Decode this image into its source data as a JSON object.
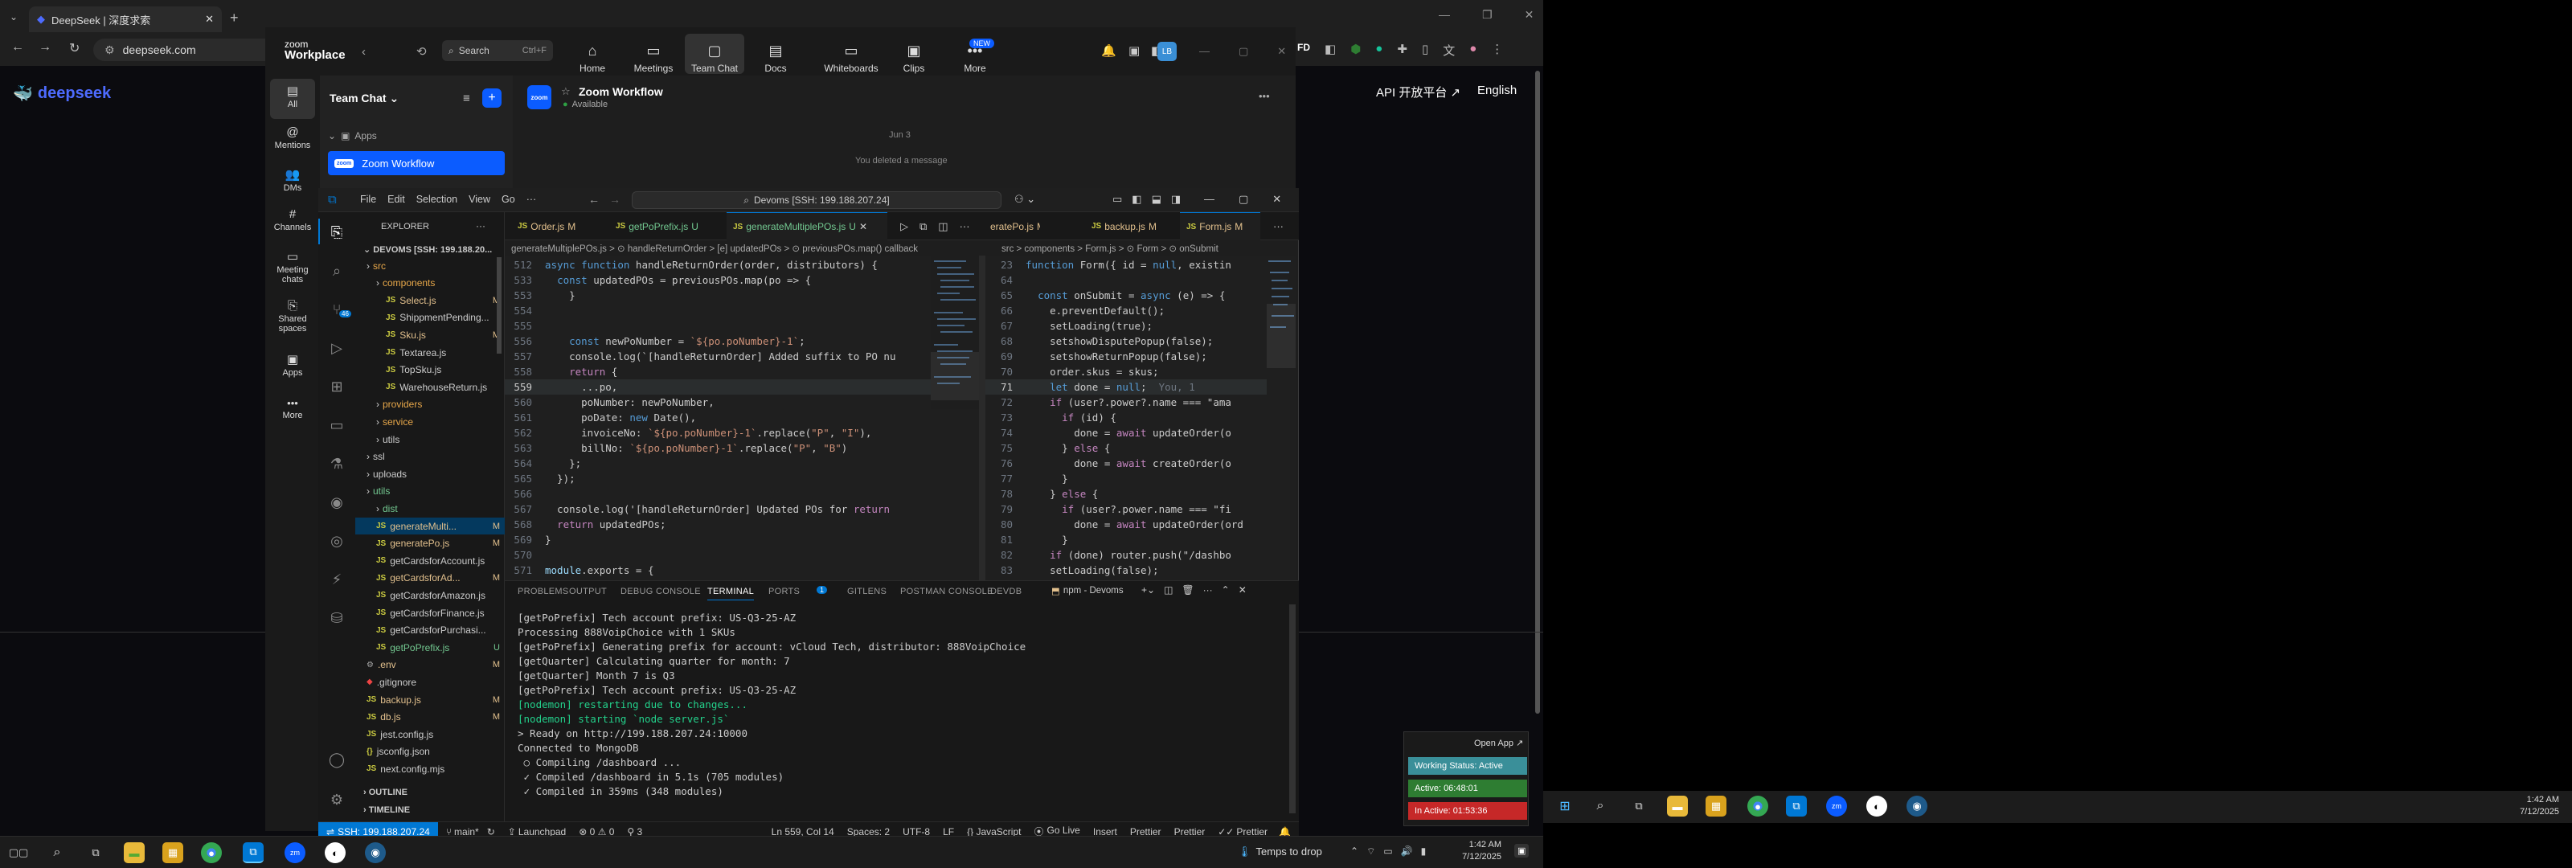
{
  "browser": {
    "tab_title": "DeepSeek | 深度求索",
    "url": "deepseek.com",
    "new_tab": "+"
  },
  "deepseek": {
    "logo_text": "deepseek",
    "api_link": "API 开放平台 ↗",
    "language": "English"
  },
  "zoom": {
    "app_name": "zoom",
    "app_sub": "Workplace",
    "search_placeholder": "Search",
    "search_shortcut": "Ctrl+F",
    "nav": [
      {
        "label": "Home",
        "icon": "home-icon"
      },
      {
        "label": "Meetings",
        "icon": "camera-icon"
      },
      {
        "label": "Team Chat",
        "icon": "chat-icon"
      },
      {
        "label": "Docs",
        "icon": "docs-icon"
      },
      {
        "label": "Whiteboards",
        "icon": "whiteboard-icon"
      },
      {
        "label": "Clips",
        "icon": "clips-icon"
      },
      {
        "label": "More",
        "icon": "more-icon"
      }
    ],
    "new_badge": "NEW",
    "avatar_initials": "LB",
    "rail": [
      "All",
      "Mentions",
      "DMs",
      "Channels",
      "Meeting chats",
      "Shared spaces",
      "Apps",
      "More"
    ],
    "list_title": "Team Chat",
    "apps_section": "Apps",
    "selected_item": "Zoom Workflow",
    "chat_title": "Zoom Workflow",
    "chat_status": "Available",
    "date_label": "Jun 3",
    "deleted_msg": "You deleted a message"
  },
  "vscode": {
    "menu": [
      "File",
      "Edit",
      "Selection",
      "View",
      "Go",
      "···"
    ],
    "command_center": "Devoms [SSH: 199.188.207.24]",
    "explorer_title": "EXPLORER",
    "root": "DEVOMS [SSH: 199.188.20...",
    "tree": [
      {
        "name": "src",
        "type": "folder",
        "depth": 0,
        "color": "#e8a84a"
      },
      {
        "name": "components",
        "type": "folder",
        "depth": 1,
        "color": "#e8a84a"
      },
      {
        "name": "Select.js",
        "type": "js",
        "depth": 2,
        "status": "M"
      },
      {
        "name": "ShippmentPending...",
        "type": "js",
        "depth": 2,
        "status": ""
      },
      {
        "name": "Sku.js",
        "type": "js",
        "depth": 2,
        "status": "M"
      },
      {
        "name": "Textarea.js",
        "type": "js",
        "depth": 2,
        "status": ""
      },
      {
        "name": "TopSku.js",
        "type": "js",
        "depth": 2,
        "status": ""
      },
      {
        "name": "WarehouseReturn.js",
        "type": "js",
        "depth": 2,
        "status": ""
      },
      {
        "name": "providers",
        "type": "folder",
        "depth": 1,
        "color": "#e8a84a"
      },
      {
        "name": "service",
        "type": "folder",
        "depth": 1,
        "color": "#e8a84a"
      },
      {
        "name": "utils",
        "type": "folder",
        "depth": 1,
        "color": "#ccc"
      },
      {
        "name": "ssl",
        "type": "folder",
        "depth": 0,
        "color": "#ccc"
      },
      {
        "name": "uploads",
        "type": "folder",
        "depth": 0,
        "color": "#ccc"
      },
      {
        "name": "utils",
        "type": "folder",
        "depth": 0,
        "color": "#73c991"
      },
      {
        "name": "dist",
        "type": "folder",
        "depth": 1,
        "color": "#73c991"
      },
      {
        "name": "generateMulti...",
        "type": "js",
        "depth": 1,
        "status": "M",
        "active": true
      },
      {
        "name": "generatePo.js",
        "type": "js",
        "depth": 1,
        "status": "M"
      },
      {
        "name": "getCardsforAccount.js",
        "type": "js",
        "depth": 1,
        "status": ""
      },
      {
        "name": "getCardsforAd...",
        "type": "js",
        "depth": 1,
        "status": "M"
      },
      {
        "name": "getCardsforAmazon.js",
        "type": "js",
        "depth": 1,
        "status": ""
      },
      {
        "name": "getCardsforFinance.js",
        "type": "js",
        "depth": 1,
        "status": ""
      },
      {
        "name": "getCardsforPurchasi...",
        "type": "js",
        "depth": 1,
        "status": ""
      },
      {
        "name": "getPoPrefix.js",
        "type": "js",
        "depth": 1,
        "status": "U"
      },
      {
        "name": ".env",
        "type": "env",
        "depth": 0,
        "status": "M"
      },
      {
        "name": ".gitignore",
        "type": "git",
        "depth": 0,
        "status": ""
      },
      {
        "name": "backup.js",
        "type": "js",
        "depth": 0,
        "status": "M"
      },
      {
        "name": "db.js",
        "type": "js",
        "depth": 0,
        "status": "M"
      },
      {
        "name": "jest.config.js",
        "type": "js",
        "depth": 0,
        "status": ""
      },
      {
        "name": "jsconfig.json",
        "type": "json",
        "depth": 0,
        "status": ""
      },
      {
        "name": "next.config.mjs",
        "type": "js",
        "depth": 0,
        "status": ""
      }
    ],
    "outline": "OUTLINE",
    "timeline": "TIMELINE",
    "tabs_left": [
      {
        "name": "Order.js",
        "status": "M"
      },
      {
        "name": "getPoPrefix.js",
        "status": "U"
      },
      {
        "name": "generateMultiplePOs.js",
        "status": "U",
        "active": true
      }
    ],
    "tabs_right": [
      {
        "name": "eratePo.js",
        "status": "M"
      },
      {
        "name": "backup.js",
        "status": "M"
      },
      {
        "name": "Form.js",
        "status": "M",
        "active": true
      }
    ],
    "breadcrumb_left": "generateMultiplePOs.js > ⊙ handleReturnOrder > [e] updatedPOs > ⊙ previousPOs.map() callback",
    "breadcrumb_right": "src > components > Form.js > ⊙ Form > ⊙ onSubmit",
    "left_lines": [
      {
        "n": "512",
        "code": "async function handleReturnOrder(order, distributors) {"
      },
      {
        "n": "533",
        "code": "  const updatedPOs = previousPOs.map(po => {"
      },
      {
        "n": "553",
        "code": "    }"
      },
      {
        "n": "554",
        "code": ""
      },
      {
        "n": "555",
        "code": ""
      },
      {
        "n": "556",
        "code": "    const newPoNumber = `${po.poNumber}-1`;"
      },
      {
        "n": "557",
        "code": "    console.log(`[handleReturnOrder] Added suffix to PO nu"
      },
      {
        "n": "558",
        "code": "    return {"
      },
      {
        "n": "559",
        "code": "      ...po,"
      },
      {
        "n": "560",
        "code": "      poNumber: newPoNumber,"
      },
      {
        "n": "561",
        "code": "      poDate: new Date(),"
      },
      {
        "n": "562",
        "code": "      invoiceNo: `${po.poNumber}-1`.replace(\"P\", \"I\"),"
      },
      {
        "n": "563",
        "code": "      billNo: `${po.poNumber}-1`.replace(\"P\", \"B\")"
      },
      {
        "n": "564",
        "code": "    };"
      },
      {
        "n": "565",
        "code": "  });"
      },
      {
        "n": "566",
        "code": ""
      },
      {
        "n": "567",
        "code": "  console.log('[handleReturnOrder] Updated POs for return "
      },
      {
        "n": "568",
        "code": "  return updatedPOs;"
      },
      {
        "n": "569",
        "code": "}"
      },
      {
        "n": "570",
        "code": ""
      },
      {
        "n": "571",
        "code": "module.exports = {"
      }
    ],
    "right_lines": [
      {
        "n": "23",
        "code": "function Form({ id = null, existin"
      },
      {
        "n": "64",
        "code": ""
      },
      {
        "n": "65",
        "code": "  const onSubmit = async (e) => {"
      },
      {
        "n": "66",
        "code": "    e.preventDefault();"
      },
      {
        "n": "67",
        "code": "    setLoading(true);"
      },
      {
        "n": "68",
        "code": "    setshowDisputePopup(false);"
      },
      {
        "n": "69",
        "code": "    setshowReturnPopup(false);"
      },
      {
        "n": "70",
        "code": "    order.skus = skus;"
      },
      {
        "n": "71",
        "code": "    let done = null;"
      },
      {
        "n": "72",
        "code": "    if (user?.power?.name === \"ama"
      },
      {
        "n": "73",
        "code": "      if (id) {"
      },
      {
        "n": "74",
        "code": "        done = await updateOrder(o"
      },
      {
        "n": "75",
        "code": "      } else {"
      },
      {
        "n": "76",
        "code": "        done = await createOrder(o"
      },
      {
        "n": "77",
        "code": "      }"
      },
      {
        "n": "78",
        "code": "    } else {"
      },
      {
        "n": "79",
        "code": "      if (user?.power.name === \"fi"
      },
      {
        "n": "80",
        "code": "        done = await updateOrder(ord"
      },
      {
        "n": "81",
        "code": "      }"
      },
      {
        "n": "82",
        "code": "    if (done) router.push(\"/dashbo"
      },
      {
        "n": "83",
        "code": "    setLoading(false);"
      }
    ],
    "inline_hint": "You, 1",
    "panel_tabs": [
      "PROBLEMS",
      "OUTPUT",
      "DEBUG CONSOLE",
      "TERMINAL",
      "PORTS",
      "GITLENS",
      "POSTMAN CONSOLE",
      "DEVDB"
    ],
    "ports_badge": "1",
    "terminal_label": "npm - Devoms",
    "terminal": [
      {
        "t": "[getPoPrefix] Tech account prefix: US-Q3-25-AZ",
        "c": "#ccc"
      },
      {
        "t": "Processing 888VoipChoice with 1 SKUs",
        "c": "#ccc"
      },
      {
        "t": "[getPoPrefix] Generating prefix for account: vCloud Tech, distributor: 888VoipChoice",
        "c": "#ccc"
      },
      {
        "t": "[getQuarter] Calculating quarter for month: 7",
        "c": "#ccc"
      },
      {
        "t": "[getQuarter] Month 7 is Q3",
        "c": "#ccc"
      },
      {
        "t": "[getPoPrefix] Tech account prefix: US-Q3-25-AZ",
        "c": "#ccc"
      },
      {
        "t": "[nodemon] restarting due to changes...",
        "c": "#23d18b"
      },
      {
        "t": "[nodemon] starting `node server.js`",
        "c": "#23d18b"
      },
      {
        "t": "> Ready on http://199.188.207.24:10000",
        "c": "#ccc"
      },
      {
        "t": "Connected to MongoDB",
        "c": "#ccc"
      },
      {
        "t": " ○ Compiling /dashboard ...",
        "c": "#ccc"
      },
      {
        "t": " ✓ Compiled /dashboard in 5.1s (705 modules)",
        "c": "#ccc"
      },
      {
        "t": " ✓ Compiled in 359ms (348 modules)",
        "c": "#ccc"
      }
    ],
    "status": {
      "remote": "SSH: 199.188.207.24",
      "branch": "main*",
      "launchpad": "Launchpad",
      "problems": "⊗ 0 ⚠ 0",
      "ports": "⚲ 3",
      "position": "Ln 559, Col 14",
      "spaces": "Spaces: 2",
      "encoding": "UTF-8",
      "eol": "LF",
      "lang": "{} JavaScript",
      "golive": "Go Live",
      "insert": "Insert",
      "prettier1": "Prettier",
      "prettier2": "Prettier",
      "prettier3": "Prettier"
    }
  },
  "taskbar1": {
    "weather": "Temps to drop",
    "time": "1:42 AM",
    "date": "7/12/2025"
  },
  "tracker": {
    "open_app": "Open App ↗",
    "working": "Working Status: Active",
    "active": "Active: 06:48:01",
    "inactive": "In Active: 01:53:36"
  },
  "taskbar2": {
    "time": "1:42 AM",
    "date": "7/12/2025"
  },
  "colors": {
    "accent_blue": "#0b5cff",
    "vscode_blue": "#0078d4",
    "deepseek_blue": "#4d6bfe",
    "tracker_green": "#2e7d32",
    "tracker_red": "#c62828",
    "tracker_teal": "#3a8f99"
  }
}
